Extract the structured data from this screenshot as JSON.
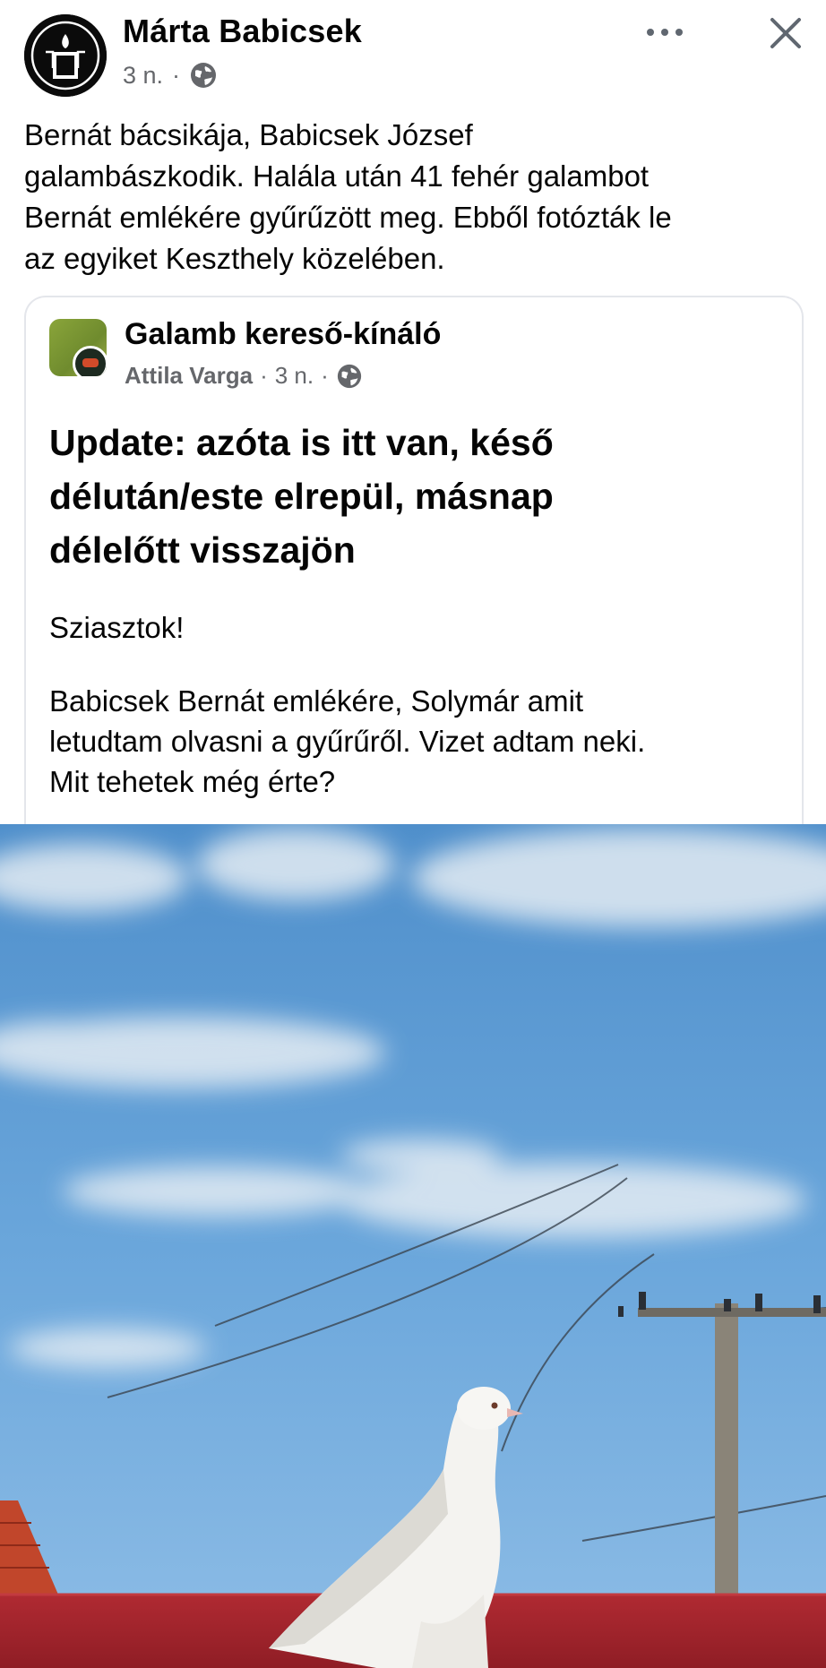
{
  "post": {
    "author": "Márta Babicsek",
    "time": "3 n.",
    "separator": "·",
    "visibility_icon": "globe-icon",
    "text_lines": [
      "Bernát bácsikája, Babicsek József",
      "galambászkodik. Halála után 41 fehér galambot",
      "Bernát emlékére gyűrűzött meg. Ebből fotózták le",
      "az egyiket Keszthely közelében."
    ],
    "actions": {
      "more_icon": "more-options-icon",
      "close_icon": "close-icon"
    }
  },
  "shared": {
    "group_name": "Galamb kereső-kínáló",
    "author": "Attila Varga",
    "separator": "·",
    "time": "3 n.",
    "visibility_icon": "globe-icon",
    "title_lines": [
      "Update: azóta is itt van, késő",
      "délután/este elrepül, másnap",
      "délelőtt visszajön"
    ],
    "greeting": "Sziasztok!",
    "body_lines": [
      "Babicsek Bernát emlékére, Solymár amit",
      "letudtam olvasni a gyűrűről. Vizet adtam neki.",
      "Mit tehetek még érte?"
    ]
  },
  "colors": {
    "text_primary": "#050505",
    "text_secondary": "#65676b",
    "card_border": "#e4e6eb",
    "sky": "#5f9fd6",
    "roof": "#a8262e"
  }
}
